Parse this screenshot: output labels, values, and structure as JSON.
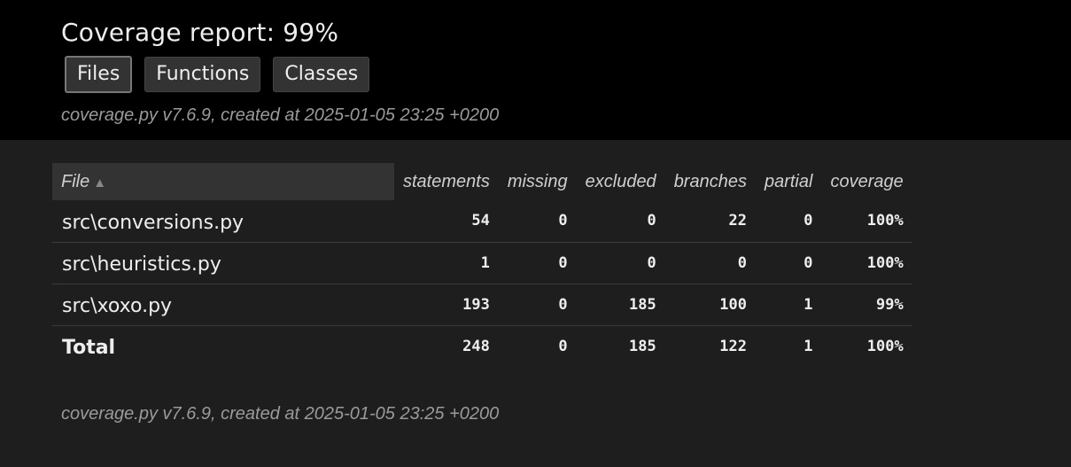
{
  "header": {
    "title": "Coverage report: 99%",
    "tabs": [
      {
        "label": "Files",
        "current": true
      },
      {
        "label": "Functions",
        "current": false
      },
      {
        "label": "Classes",
        "current": false
      }
    ],
    "meta": "coverage.py v7.6.9, created at 2025-01-05 23:25 +0200"
  },
  "table": {
    "columns": [
      "File",
      "statements",
      "missing",
      "excluded",
      "branches",
      "partial",
      "coverage"
    ],
    "sort_indicator": "▲",
    "rows": [
      {
        "file": "src\\conversions.py",
        "statements": "54",
        "missing": "0",
        "excluded": "0",
        "branches": "22",
        "partial": "0",
        "coverage": "100%"
      },
      {
        "file": "src\\heuristics.py",
        "statements": "1",
        "missing": "0",
        "excluded": "0",
        "branches": "0",
        "partial": "0",
        "coverage": "100%"
      },
      {
        "file": "src\\xoxo.py",
        "statements": "193",
        "missing": "0",
        "excluded": "185",
        "branches": "100",
        "partial": "1",
        "coverage": "99%"
      }
    ],
    "total": {
      "file": "Total",
      "statements": "248",
      "missing": "0",
      "excluded": "185",
      "branches": "122",
      "partial": "1",
      "coverage": "100%"
    }
  },
  "footer": {
    "meta": "coverage.py v7.6.9, created at 2025-01-05 23:25 +0200"
  },
  "colors": {
    "header_bg": "#000000",
    "page_bg": "#1e1e1e",
    "text": "#eeeeee",
    "muted": "#9a9a9a"
  }
}
